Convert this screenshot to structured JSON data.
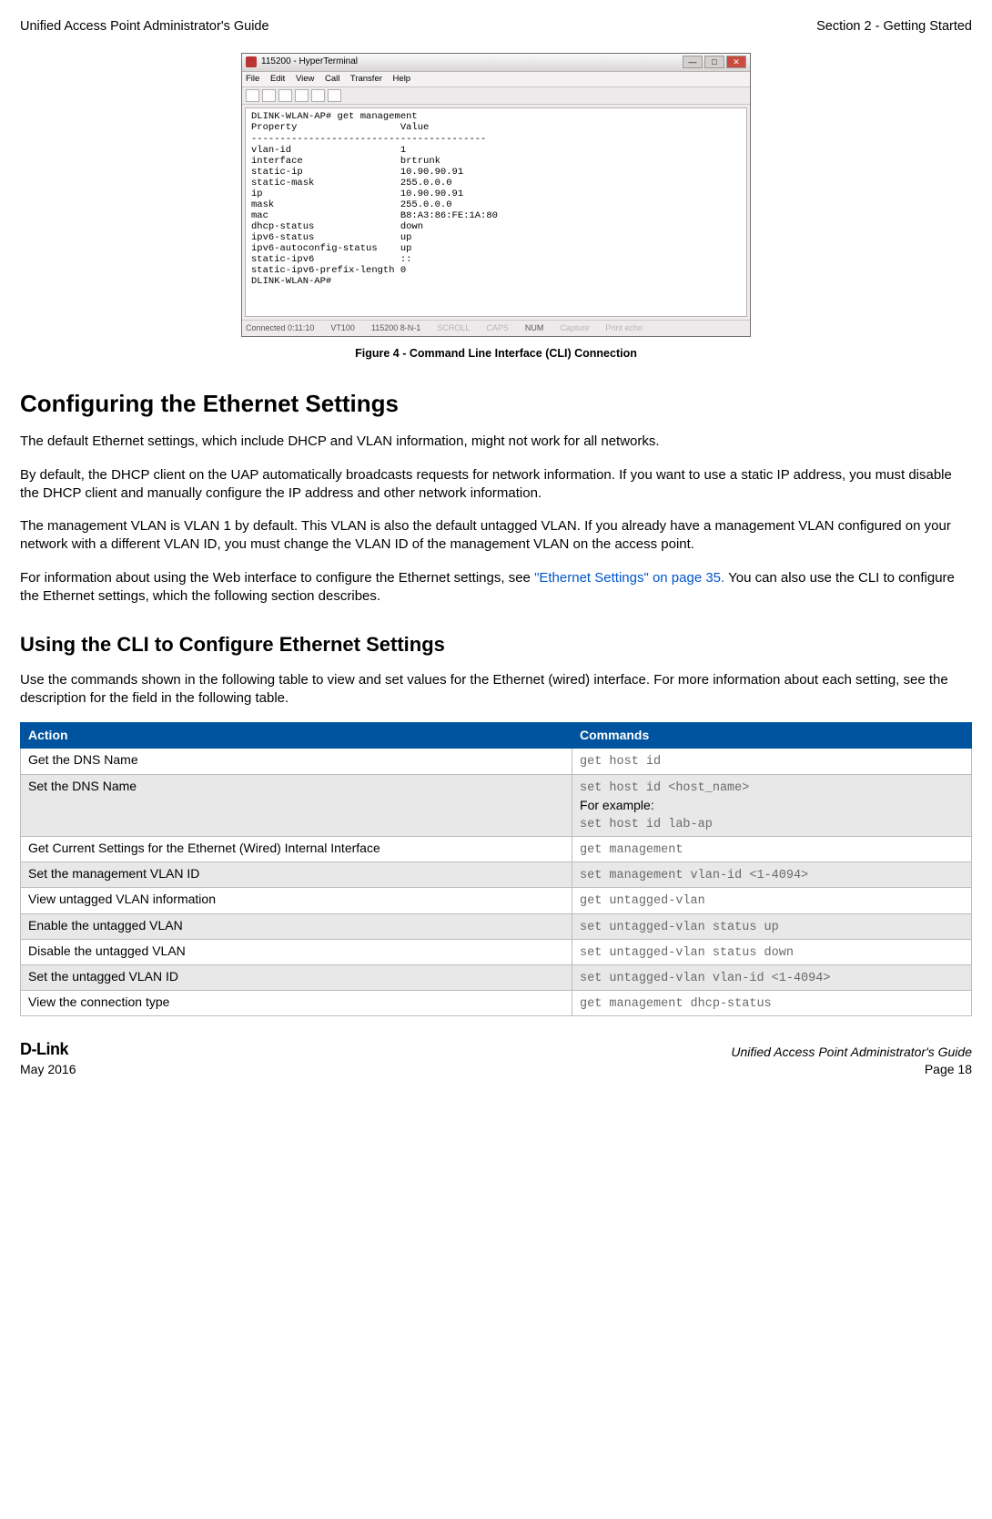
{
  "header": {
    "left": "Unified Access Point Administrator's Guide",
    "right": "Section 2 - Getting Started"
  },
  "terminal": {
    "title": "115200 - HyperTerminal",
    "menu": [
      "File",
      "Edit",
      "View",
      "Call",
      "Transfer",
      "Help"
    ],
    "body": "DLINK-WLAN-AP# get management\nProperty                  Value\n-----------------------------------------\nvlan-id                   1\ninterface                 brtrunk\nstatic-ip                 10.90.90.91\nstatic-mask               255.0.0.0\nip                        10.90.90.91\nmask                      255.0.0.0\nmac                       B8:A3:86:FE:1A:80\ndhcp-status               down\nipv6-status               up\nipv6-autoconfig-status    up\nstatic-ipv6               ::\nstatic-ipv6-prefix-length 0\nDLINK-WLAN-AP#",
    "status": {
      "conn": "Connected 0:11:10",
      "term": "VT100",
      "baud": "115200 8-N-1",
      "scroll": "SCROLL",
      "caps": "CAPS",
      "num": "NUM",
      "capture": "Capture",
      "echo": "Print echo"
    }
  },
  "figcaption": "Figure 4 - Command Line Interface (CLI) Connection",
  "h_configure": "Configuring the Ethernet Settings",
  "p1": "The default Ethernet settings, which include DHCP and VLAN information, might not work for all networks.",
  "p2": "By default, the DHCP client on the UAP automatically broadcasts requests for network information. If you want to use a static IP address, you must disable the DHCP client and manually configure the IP address and other network information.",
  "p3": "The management VLAN is VLAN 1 by default. This VLAN is also the default untagged VLAN. If you already have a management VLAN configured on your network with a different VLAN ID, you must change the VLAN ID of the management VLAN on the access point.",
  "p4a": "For information about using the Web interface to configure the Ethernet settings, see ",
  "p4link": "\"Ethernet Settings\" on page 35.",
  "p4b": " You can also use the CLI to configure the Ethernet settings, which the following section describes.",
  "h_cli": "Using the CLI to Configure Ethernet Settings",
  "p5": "Use the commands shown in the following table to view and set values for the Ethernet (wired) interface. For more information about each setting, see the description for the field in the following table.",
  "table": {
    "headers": {
      "action": "Action",
      "commands": "Commands"
    },
    "rows": [
      {
        "action": "Get the DNS Name",
        "cmd": "get host id"
      },
      {
        "action": "Set the DNS Name",
        "cmd1": "set host id <host_name>",
        "plain": "For example:",
        "cmd2": "set host id lab-ap"
      },
      {
        "action": "Get Current Settings for the Ethernet (Wired) Internal Interface",
        "cmd": "get management"
      },
      {
        "action": "Set the management VLAN ID",
        "cmd": "set management vlan-id <1-4094>"
      },
      {
        "action": "View untagged VLAN information",
        "cmd": "get untagged-vlan"
      },
      {
        "action": "Enable the untagged VLAN",
        "cmd": "set untagged-vlan status up"
      },
      {
        "action": "Disable the untagged VLAN",
        "cmd": "set untagged-vlan status down"
      },
      {
        "action": "Set the untagged VLAN ID",
        "cmd": "set untagged-vlan vlan-id <1-4094>"
      },
      {
        "action": "View the connection type",
        "cmd": "get management dhcp-status"
      }
    ]
  },
  "footer": {
    "brand": "D-Link",
    "date": "May 2016",
    "doc": "Unified Access Point Administrator's Guide",
    "page": "Page 18"
  }
}
